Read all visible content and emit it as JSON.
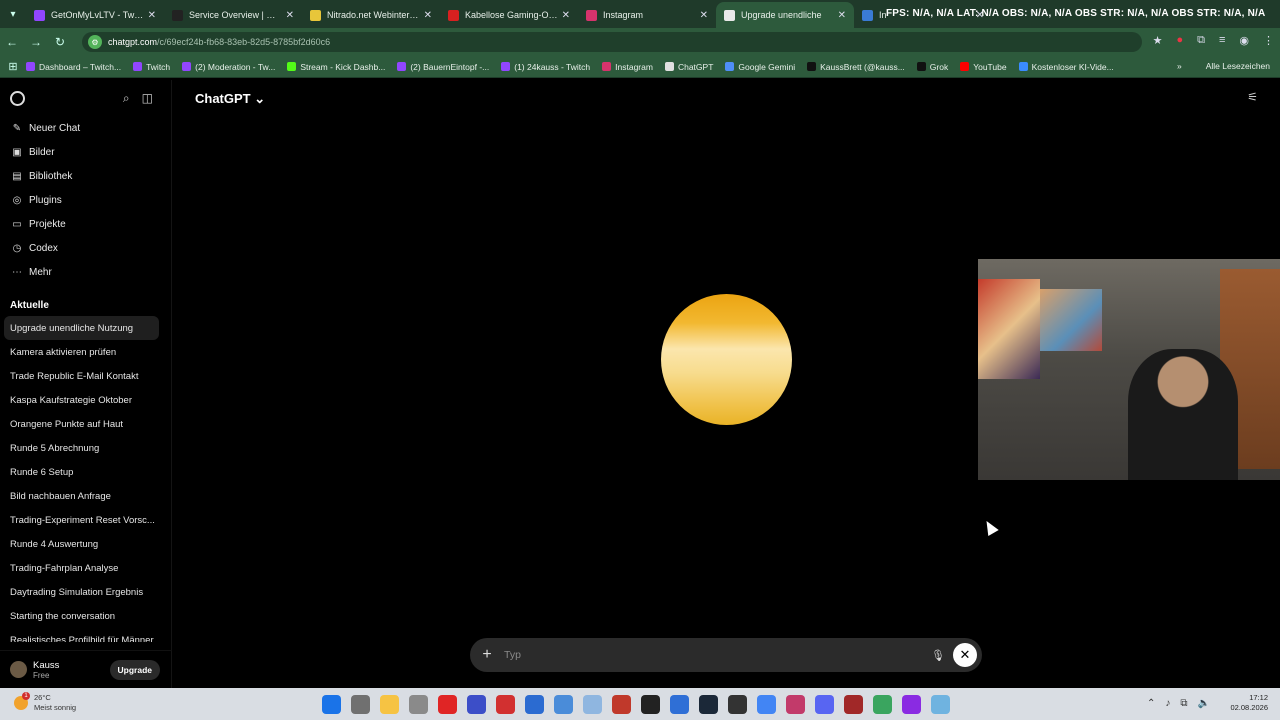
{
  "tabs": [
    {
      "title": "GetOnMyLvLTV - Twitch",
      "color": "#9146ff",
      "active": false
    },
    {
      "title": "Service Overview | Nitrado",
      "color": "#222",
      "active": false
    },
    {
      "title": "Nitrado.net Webinterface",
      "color": "#e8c63a",
      "active": false
    },
    {
      "title": "Kabellose Gaming-Ohrhö",
      "color": "#d72020",
      "active": false
    },
    {
      "title": "Instagram",
      "color": "#d6336c",
      "active": false
    },
    {
      "title": "Upgrade unendliche",
      "color": "#e9e9e9",
      "active": true
    },
    {
      "title": "In",
      "color": "#3a7bd5",
      "active": false
    }
  ],
  "tab_overlay_text": "FPS: N/A, N/A   LAT: N/A   OBS: N/A, N/A   OBS STR: N/A, N/A   OBS STR: N/A, N/A",
  "address": {
    "host": "chatgpt.com",
    "path": "/c/69ecf24b-fb68-83eb-82d5-8785bf2d60c6"
  },
  "bookmarks": [
    {
      "label": "Dashboard – Twitch...",
      "color": "#9146ff"
    },
    {
      "label": "Twitch",
      "color": "#9146ff"
    },
    {
      "label": "(2) Moderation - Tw...",
      "color": "#9146ff"
    },
    {
      "label": "Stream - Kick Dashb...",
      "color": "#53fc18"
    },
    {
      "label": "(2) BauernEintopf -...",
      "color": "#9146ff"
    },
    {
      "label": "(1) 24kauss - Twitch",
      "color": "#9146ff"
    },
    {
      "label": "Instagram",
      "color": "#d6336c"
    },
    {
      "label": "ChatGPT",
      "color": "#e0e0e0"
    },
    {
      "label": "Google Gemini",
      "color": "#4f8ef7"
    },
    {
      "label": "KaussBrett (@kauss...",
      "color": "#111"
    },
    {
      "label": "Grok",
      "color": "#111"
    },
    {
      "label": "YouTube",
      "color": "#ff0000"
    },
    {
      "label": "Kostenloser KI-Vide...",
      "color": "#3a8bff"
    }
  ],
  "bookmarks_all": "Alle Lesezeichen",
  "sidebar": {
    "nav": [
      {
        "label": "Neuer Chat",
        "icon": "✎"
      },
      {
        "label": "Bilder",
        "icon": "▣"
      },
      {
        "label": "Bibliothek",
        "icon": "▤"
      },
      {
        "label": "Plugins",
        "icon": "◎"
      },
      {
        "label": "Projekte",
        "icon": "▭"
      },
      {
        "label": "Codex",
        "icon": "◷"
      },
      {
        "label": "Mehr",
        "icon": "⋯"
      }
    ],
    "section_title": "Aktuelle",
    "chats": [
      "Upgrade unendliche Nutzung",
      "Kamera aktivieren prüfen",
      "Trade Republic E-Mail Kontakt",
      "Kaspa Kaufstrategie Oktober",
      "Orangene Punkte auf Haut",
      "Runde 5 Abrechnung",
      "Runde 6 Setup",
      "Bild nachbauen Anfrage",
      "Trading-Experiment Reset Vorsc...",
      "Runde 4 Auswertung",
      "Trading-Fahrplan Analyse",
      "Daytrading Simulation Ergebnis",
      "Starting the conversation",
      "Realistisches Profilbild für Männer"
    ],
    "user": {
      "name": "Kauss",
      "plan": "Free"
    },
    "upgrade_label": "Upgrade"
  },
  "main": {
    "title": "ChatGPT ⌄"
  },
  "composer": {
    "placeholder": "Typ"
  },
  "taskbar": {
    "weather_temp": "26°C",
    "weather_desc": "Meist sonnig",
    "weather_badge": "1",
    "time": "17:12",
    "date": "02.08.2026",
    "apps": [
      "#1a73e8",
      "#707070",
      "#f6c343",
      "#8a8a8a",
      "#e02525",
      "#3c4ec8",
      "#d23030",
      "#2b6bd1",
      "#4a8cd9",
      "#8fb6e0",
      "#c0392b",
      "#222",
      "#2f6fd6",
      "#1b2838",
      "#333",
      "#4285f4",
      "#c23a6a",
      "#5865f2",
      "#a12828",
      "#3aa55f",
      "#8a2be2",
      "#6fb3e0"
    ]
  }
}
